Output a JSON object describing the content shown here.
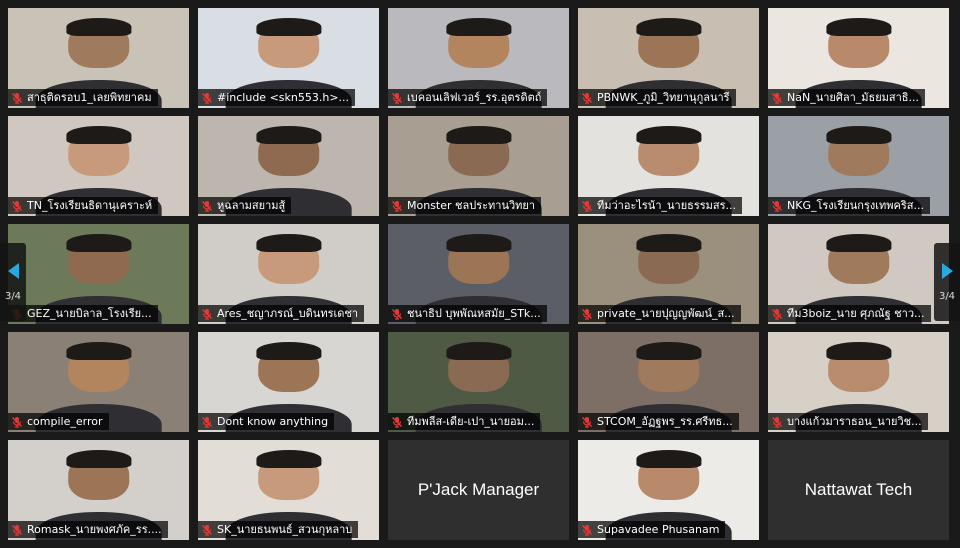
{
  "pagination": {
    "left": "3/4",
    "right": "3/4"
  },
  "accent": "#2aa8e0",
  "mic_muted_color": "#e53935",
  "tiles": [
    {
      "name": "สาธุติดรอบ1_เลยพิทยาคม",
      "bg": "#c9c2b6",
      "skin": "#a07a5c"
    },
    {
      "name": "#include <skn553.h>...",
      "bg": "#d8dee4",
      "skin": "#c79a7c"
    },
    {
      "name": "เบคอนเลิฟเวอร์_รร.อุตรดิตถ์",
      "bg": "#b9b9be",
      "skin": "#b3855f"
    },
    {
      "name": "PBNWK_ภูมิ_วิทยานุกูลนารี",
      "bg": "#c8bfb2",
      "skin": "#9c7556"
    },
    {
      "name": "NaN_นายศิลา_มัธยมสาธิ...",
      "bg": "#ebe6e0",
      "skin": "#b8896b"
    },
    {
      "name": "TN_โรงเรียนธิดานุเคราะห์",
      "bg": "#cfc7c0",
      "skin": "#c79a7c"
    },
    {
      "name": "หูฉลามสยามสู้",
      "bg": "#bdb6ae",
      "skin": "#8f6a50"
    },
    {
      "name": "Monster ชลประทานวิทยา",
      "bg": "#a89e92",
      "skin": "#8a6a52"
    },
    {
      "name": "ทีมว่าอะไรน้า_นายธรรมสร...",
      "bg": "#e4e2df",
      "skin": "#b88c6c"
    },
    {
      "name": "NKG_โรงเรียนกรุงเทพคริส...",
      "bg": "#9aa0a6",
      "skin": "#a07a5c"
    },
    {
      "name": "GEZ_นายบิลาล_โรงเรีย...",
      "bg": "#6c7a5a",
      "skin": "#8f6a50"
    },
    {
      "name": "Ares_ชญาภรณ์_บดินทรเดชา",
      "bg": "#d0cdc8",
      "skin": "#c79a7c"
    },
    {
      "name": "ชนาธิป บุพพัณหสมัย_STk...",
      "bg": "#5b5e66",
      "skin": "#9c7556"
    },
    {
      "name": "private_นายปุญญพัฒน์_ส...",
      "bg": "#9b8f7e",
      "skin": "#8a6a52"
    },
    {
      "name": "ทีม3boiz_นาย ศุภณัฐ ชาว...",
      "bg": "#cfc9c1",
      "skin": "#a07a5c"
    },
    {
      "name": "compile_error",
      "bg": "#8a8076",
      "skin": "#b3855f"
    },
    {
      "name": "Dont know anything",
      "bg": "#d8d6d2",
      "skin": "#9c7556"
    },
    {
      "name": "ทีมพลีส-เดีย-เปา_นายอม...",
      "bg": "#4e5a44",
      "skin": "#8a6a52"
    },
    {
      "name": "STCOM_อัฏฐพร_รร.ศรีทธ...",
      "bg": "#7e6f66",
      "skin": "#a07a5c"
    },
    {
      "name": "บางแก้วมาราธอน_นายวิช...",
      "bg": "#d6d0c6",
      "skin": "#b88c6c"
    },
    {
      "name": "Romask_นายพงศภัค_รร....",
      "bg": "#d3d0cb",
      "skin": "#9c7556"
    },
    {
      "name": "SK_นายธนพนธ์_สวนกุหลาบ",
      "bg": "#e2ddd6",
      "skin": "#c79a7c"
    },
    {
      "name": "",
      "text_only": "P'Jack Manager"
    },
    {
      "name": "Supavadee Phusanam",
      "bg": "#ecebe8",
      "skin": "#b8896b"
    },
    {
      "name": "",
      "text_only": "Nattawat Tech"
    }
  ]
}
